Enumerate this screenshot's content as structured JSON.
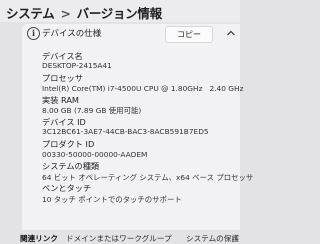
{
  "breadcrumb": {
    "parent": "システム",
    "separator": ">",
    "current": "バージョン情報"
  },
  "device_specs": {
    "title": "デバイスの仕様",
    "copy_label": "コピー",
    "items": [
      {
        "label": "デバイス名",
        "value": "DESKTOP-2415A41"
      },
      {
        "label": "プロセッサ",
        "value": "Intel(R) Core(TM) i7-4500U CPU @ 1.80GHz   2.40 GHz"
      },
      {
        "label": "実装 RAM",
        "value": "8.00 GB (7.89 GB 使用可能)"
      },
      {
        "label": "デバイス ID",
        "value": "3C12BC61-3AE7-44CB-BAC3-8ACB591B7ED5"
      },
      {
        "label": "プロダクト ID",
        "value": "00330-50000-00000-AAOEM"
      },
      {
        "label": "システムの種類",
        "value": "64 ビット オペレーティング システム、x64 ベース プロセッサ"
      },
      {
        "label": "ペンとタッチ",
        "value": "10 タッチ ポイントでのタッチのサポート"
      }
    ]
  },
  "related_links": {
    "label": "関連リンク",
    "links": [
      "ドメインまたはワークグループ",
      "システムの保護"
    ]
  }
}
